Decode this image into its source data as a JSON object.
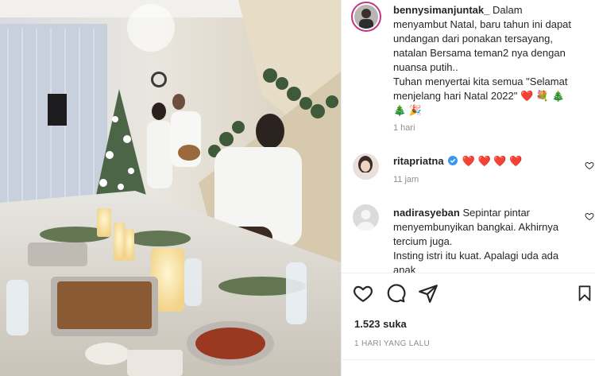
{
  "post": {
    "author_username": "bennysimanjuntak_",
    "caption": "Dalam menyambut Natal, baru tahun ini dapat undangan dari ponakan tersayang, natalan Bersama teman2 nya dengan nuansa putih..",
    "caption_line2": "Tuhan menyertai kita semua \"Selamat menjelang hari Natal 2022\" ❤️ 💐 🎄 🎄 🎉",
    "time_ago": "1 hari"
  },
  "comments": [
    {
      "username": "ritapriatna",
      "verified": true,
      "text": "❤️ ❤️ ❤️ ❤️",
      "time_ago": "11 jam"
    },
    {
      "username": "nadirasyeban",
      "verified": false,
      "text": "Sepintar pintar menyembunyikan bangkai. Akhirnya tercium juga.",
      "text_line2": "Insting istri itu kuat. Apalagi uda ada anak",
      "time_ago": ""
    }
  ],
  "stats": {
    "likes": "1.523 suka",
    "date": "1 HARI YANG LALU"
  },
  "icons": {
    "like": "heart-icon",
    "comment": "comment-icon",
    "share": "share-icon",
    "save": "bookmark-icon",
    "verified": "verified-badge-icon"
  },
  "colors": {
    "verified": "#3897f0",
    "heart_red": "#ed4956",
    "muted": "#8e8e8e",
    "text": "#262626",
    "story_ring": "#c13584"
  }
}
